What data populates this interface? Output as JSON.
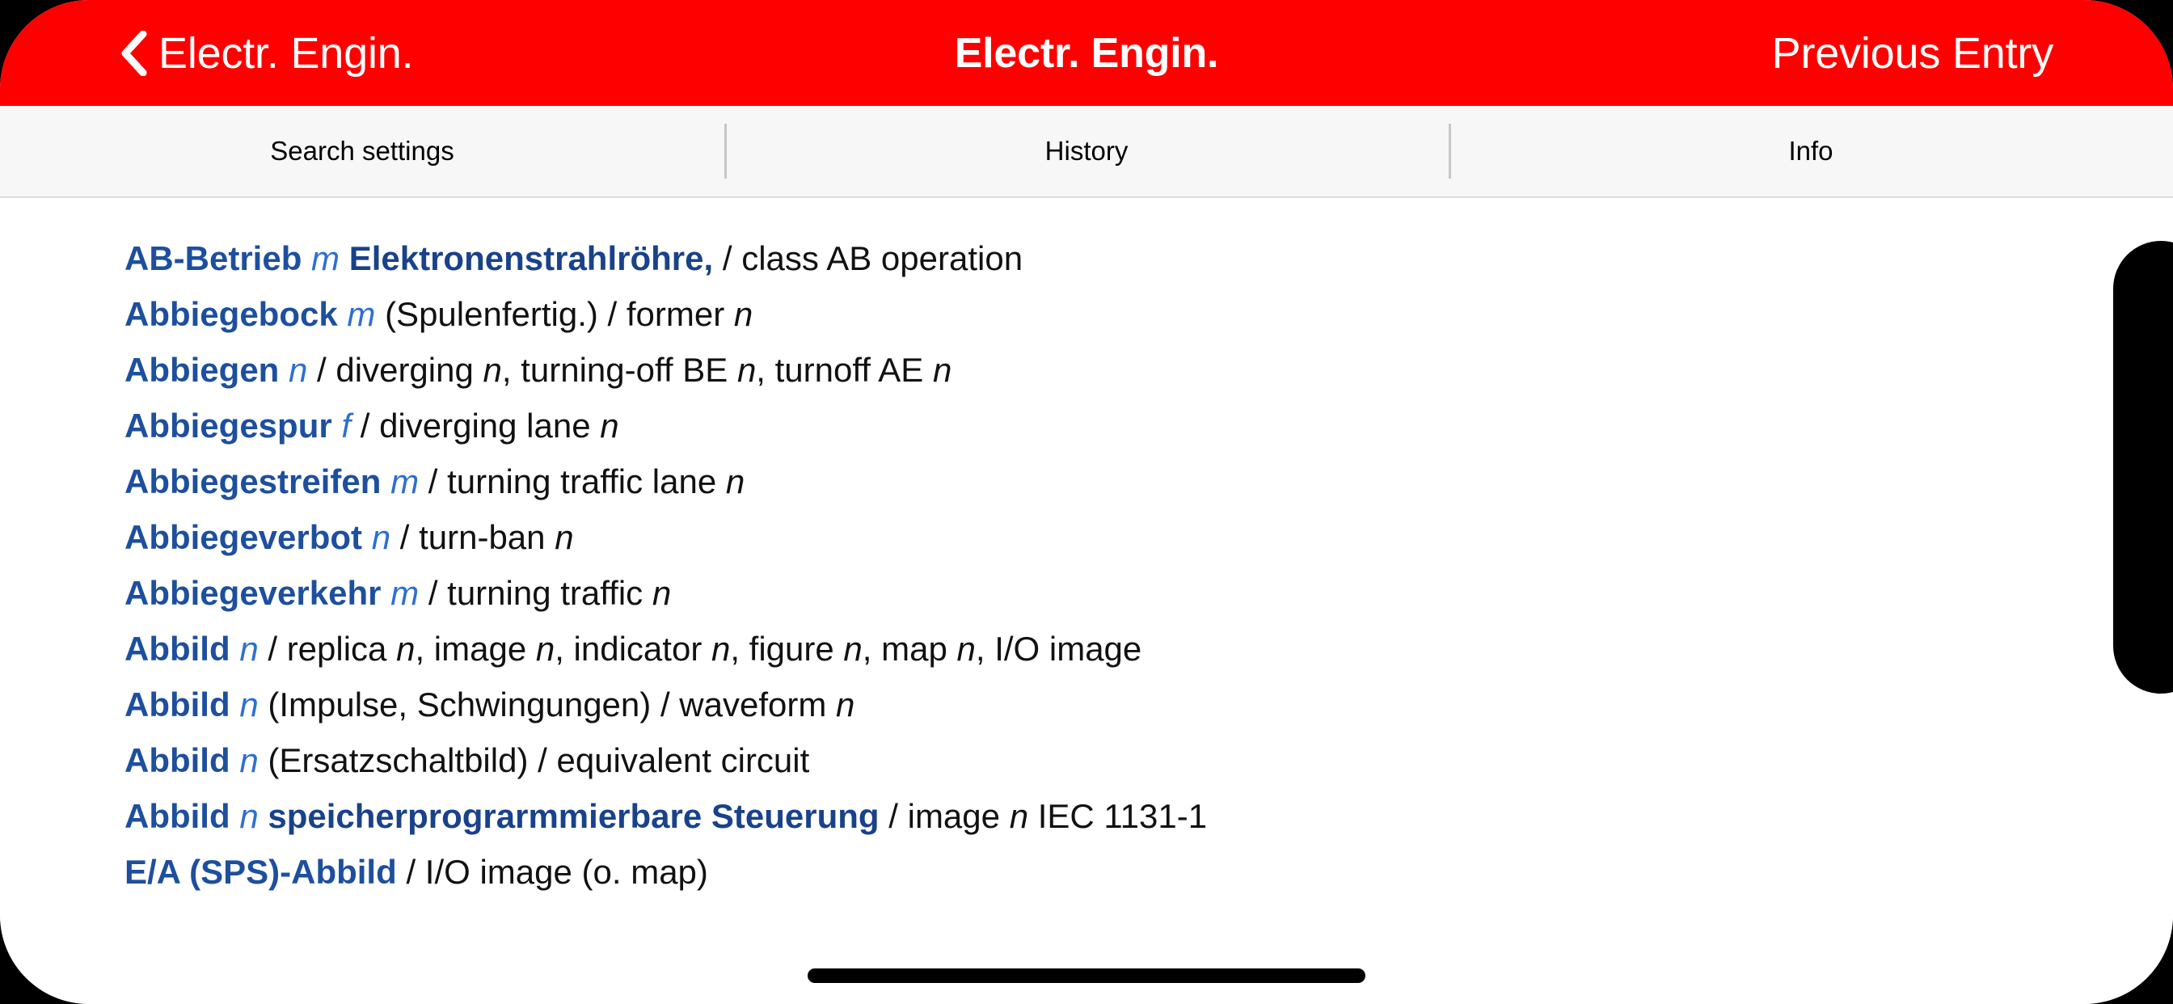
{
  "navbar": {
    "back_icon": "chevron-left-icon",
    "back_label": "Electr. Engin.",
    "title": "Electr. Engin.",
    "right_button_label": "Previous Entry",
    "background_color": "#ff0000",
    "text_color": "#ffffff"
  },
  "tabs": [
    {
      "label": "Search settings"
    },
    {
      "label": "History"
    },
    {
      "label": "Info"
    }
  ],
  "colors": {
    "accent_red": "#ff0000",
    "headword_blue": "#1d4f9e",
    "gender_blue": "#2e6fd0",
    "tabbar_background": "#f7f7f7",
    "divider": "#c7c7c7",
    "body_text": "#111111"
  },
  "entries": [
    {
      "headword": "AB-Betrieb",
      "gender": "m",
      "subject": "Elektronenstrahlröhre,",
      "separator": "/",
      "translation": "class AB operation"
    },
    {
      "headword": "Abbiegebock",
      "gender": "m",
      "context": "(Spulenfertig.)",
      "separator": "/",
      "translation": "former",
      "translation_tag": "n"
    },
    {
      "headword": "Abbiegen",
      "gender": "n",
      "separator": "/",
      "translation": "diverging",
      "translation_tag": "n",
      "translation_rest": ", turning-off BE",
      "translation_tag2": "n",
      "translation_rest2": ", turnoff AE",
      "translation_tag3": "n"
    },
    {
      "headword": "Abbiegespur",
      "gender": "f",
      "separator": "/",
      "translation": "diverging lane",
      "translation_tag": "n"
    },
    {
      "headword": "Abbiegestreifen",
      "gender": "m",
      "separator": "/",
      "translation": "turning traffic lane",
      "translation_tag": "n"
    },
    {
      "headword": "Abbiegeverbot",
      "gender": "n",
      "separator": "/",
      "translation": "turn-ban",
      "translation_tag": "n"
    },
    {
      "headword": "Abbiegeverkehr",
      "gender": "m",
      "separator": "/",
      "translation": "turning traffic",
      "translation_tag": "n"
    },
    {
      "headword": "Abbild",
      "gender": "n",
      "separator": "/",
      "translation": "replica",
      "translation_tag": "n",
      "translation_rest": ", image",
      "translation_tag2": "n",
      "translation_rest2": ", indicator",
      "translation_tag3": "n",
      "translation_rest3": ", figure",
      "translation_tag4": "n",
      "translation_rest4": ", map",
      "translation_tag5": "n",
      "translation_rest5": ", I/O image"
    },
    {
      "headword": "Abbild",
      "gender": "n",
      "context": "(Impulse, Schwingungen)",
      "separator": "/",
      "translation": "waveform",
      "translation_tag": "n"
    },
    {
      "headword": "Abbild",
      "gender": "n",
      "context": "(Ersatzschaltbild)",
      "separator": "/",
      "translation": "equivalent circuit"
    },
    {
      "headword": "Abbild",
      "gender": "n",
      "subject": "speicherprograrmmierbare Steuerung",
      "separator": "/",
      "translation": "image",
      "translation_tag": "n",
      "translation_rest": " IEC 1131-1"
    },
    {
      "headword": "E/A (SPS)-Abbild",
      "separator": "/",
      "translation": "I/O image (o. map)"
    }
  ]
}
